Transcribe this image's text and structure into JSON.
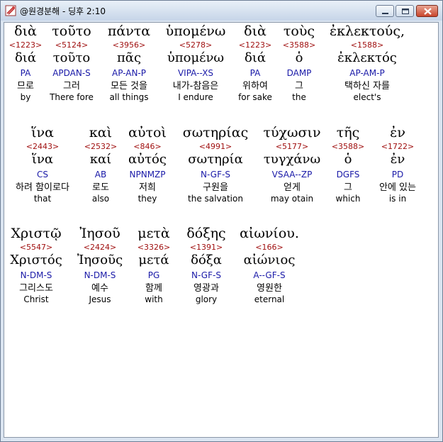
{
  "window": {
    "title": "@원경분해 - 딩후 2:10"
  },
  "rows": [
    {
      "words": [
        {
          "g": "διὰ",
          "s": "<1223>",
          "l": "διά",
          "p": "PA",
          "k": "므로",
          "e": "by"
        },
        {
          "g": "τοῦτο",
          "s": "<5124>",
          "l": "τοῦτο",
          "p": "APDAN-S",
          "k": "그러",
          "e": "There fore"
        },
        {
          "g": "πάντα",
          "s": "<3956>",
          "l": "πᾶς",
          "p": "AP-AN-P",
          "k": "모든 것을",
          "e": "all things"
        },
        {
          "g": "ὑπομένω",
          "s": "<5278>",
          "l": "ὑπομένω",
          "p": "VIPA--XS",
          "k": "내가-참음은",
          "e": "I endure"
        },
        {
          "g": "διὰ",
          "s": "<1223>",
          "l": "διά",
          "p": "PA",
          "k": "위하여",
          "e": "for sake"
        },
        {
          "g": "τοὺς",
          "s": "<3588>",
          "l": "ὁ",
          "p": "DAMP",
          "k": "그",
          "e": "the"
        },
        {
          "g": "ἐκλεκτούς,",
          "s": "<1588>",
          "l": "ἐκλεκτός",
          "p": "AP-AM-P",
          "k": "택하신 자를",
          "e": "elect's"
        }
      ]
    },
    {
      "words": [
        {
          "g": "ἵνα",
          "s": "<2443>",
          "l": "ἵνα",
          "p": "CS",
          "k": "하려 함이로다",
          "e": "that"
        },
        {
          "g": "καὶ",
          "s": "<2532>",
          "l": "καί",
          "p": "AB",
          "k": "로도",
          "e": "also"
        },
        {
          "g": "αὐτοὶ",
          "s": "<846>",
          "l": "αὐτός",
          "p": "NPNMZP",
          "k": "저희",
          "e": "they"
        },
        {
          "g": "σωτηρίας",
          "s": "<4991>",
          "l": "σωτηρία",
          "p": "N-GF-S",
          "k": "구원을",
          "e": "the salvation"
        },
        {
          "g": "τύχωσιν",
          "s": "<5177>",
          "l": "τυγχάνω",
          "p": "VSAA--ZP",
          "k": "얻게",
          "e": "may otain"
        },
        {
          "g": "τῆς",
          "s": "<3588>",
          "l": "ὁ",
          "p": "DGFS",
          "k": "그",
          "e": "which"
        },
        {
          "g": "ἐν",
          "s": "<1722>",
          "l": "ἐν",
          "p": "PD",
          "k": "안에 있는",
          "e": "is in"
        }
      ]
    },
    {
      "words": [
        {
          "g": "Χριστῷ",
          "s": "<5547>",
          "l": "Χριστός",
          "p": "N-DM-S",
          "k": "그리스도",
          "e": "Christ"
        },
        {
          "g": "Ἰησοῦ",
          "s": "<2424>",
          "l": "Ἰησοῦς",
          "p": "N-DM-S",
          "k": "예수",
          "e": "Jesus"
        },
        {
          "g": "μετὰ",
          "s": "<3326>",
          "l": "μετά",
          "p": "PG",
          "k": "함께",
          "e": "with"
        },
        {
          "g": "δόξης",
          "s": "<1391>",
          "l": "δόξα",
          "p": "N-GF-S",
          "k": "영광과",
          "e": "glory"
        },
        {
          "g": "αἰωνίου.",
          "s": "<166>",
          "l": "αἰώνιος",
          "p": "A--GF-S",
          "k": "영원한",
          "e": "eternal"
        }
      ]
    }
  ]
}
